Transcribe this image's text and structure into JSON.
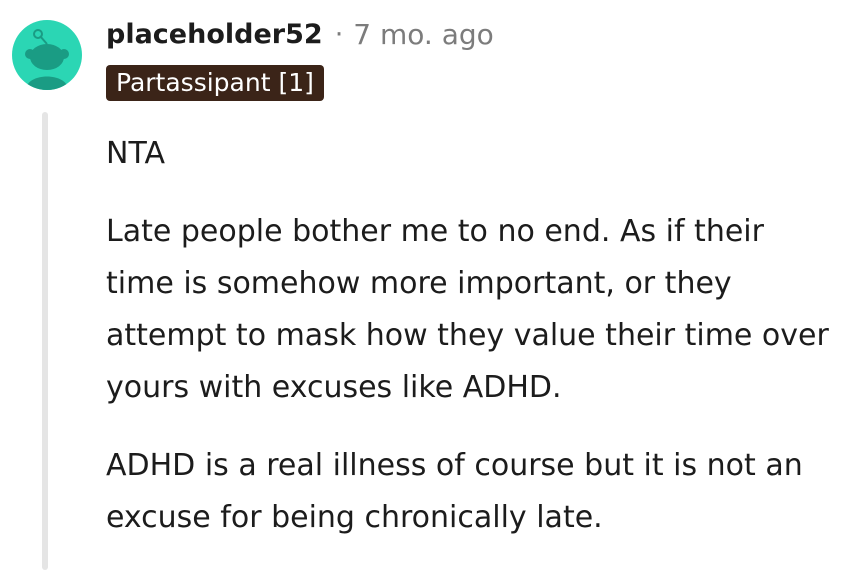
{
  "comment": {
    "username": "placeholder52",
    "separator": "·",
    "timestamp": "7 mo. ago",
    "flair": "Partassipant [1]",
    "avatar_color": "#2bd6b4",
    "paragraphs": [
      "NTA",
      "Late people bother me to no end. As if their time is somehow more important, or they attempt to mask how they value their time over yours with excuses like ADHD.",
      "ADHD is a real illness of course but it is not an excuse for being chronically late."
    ]
  }
}
